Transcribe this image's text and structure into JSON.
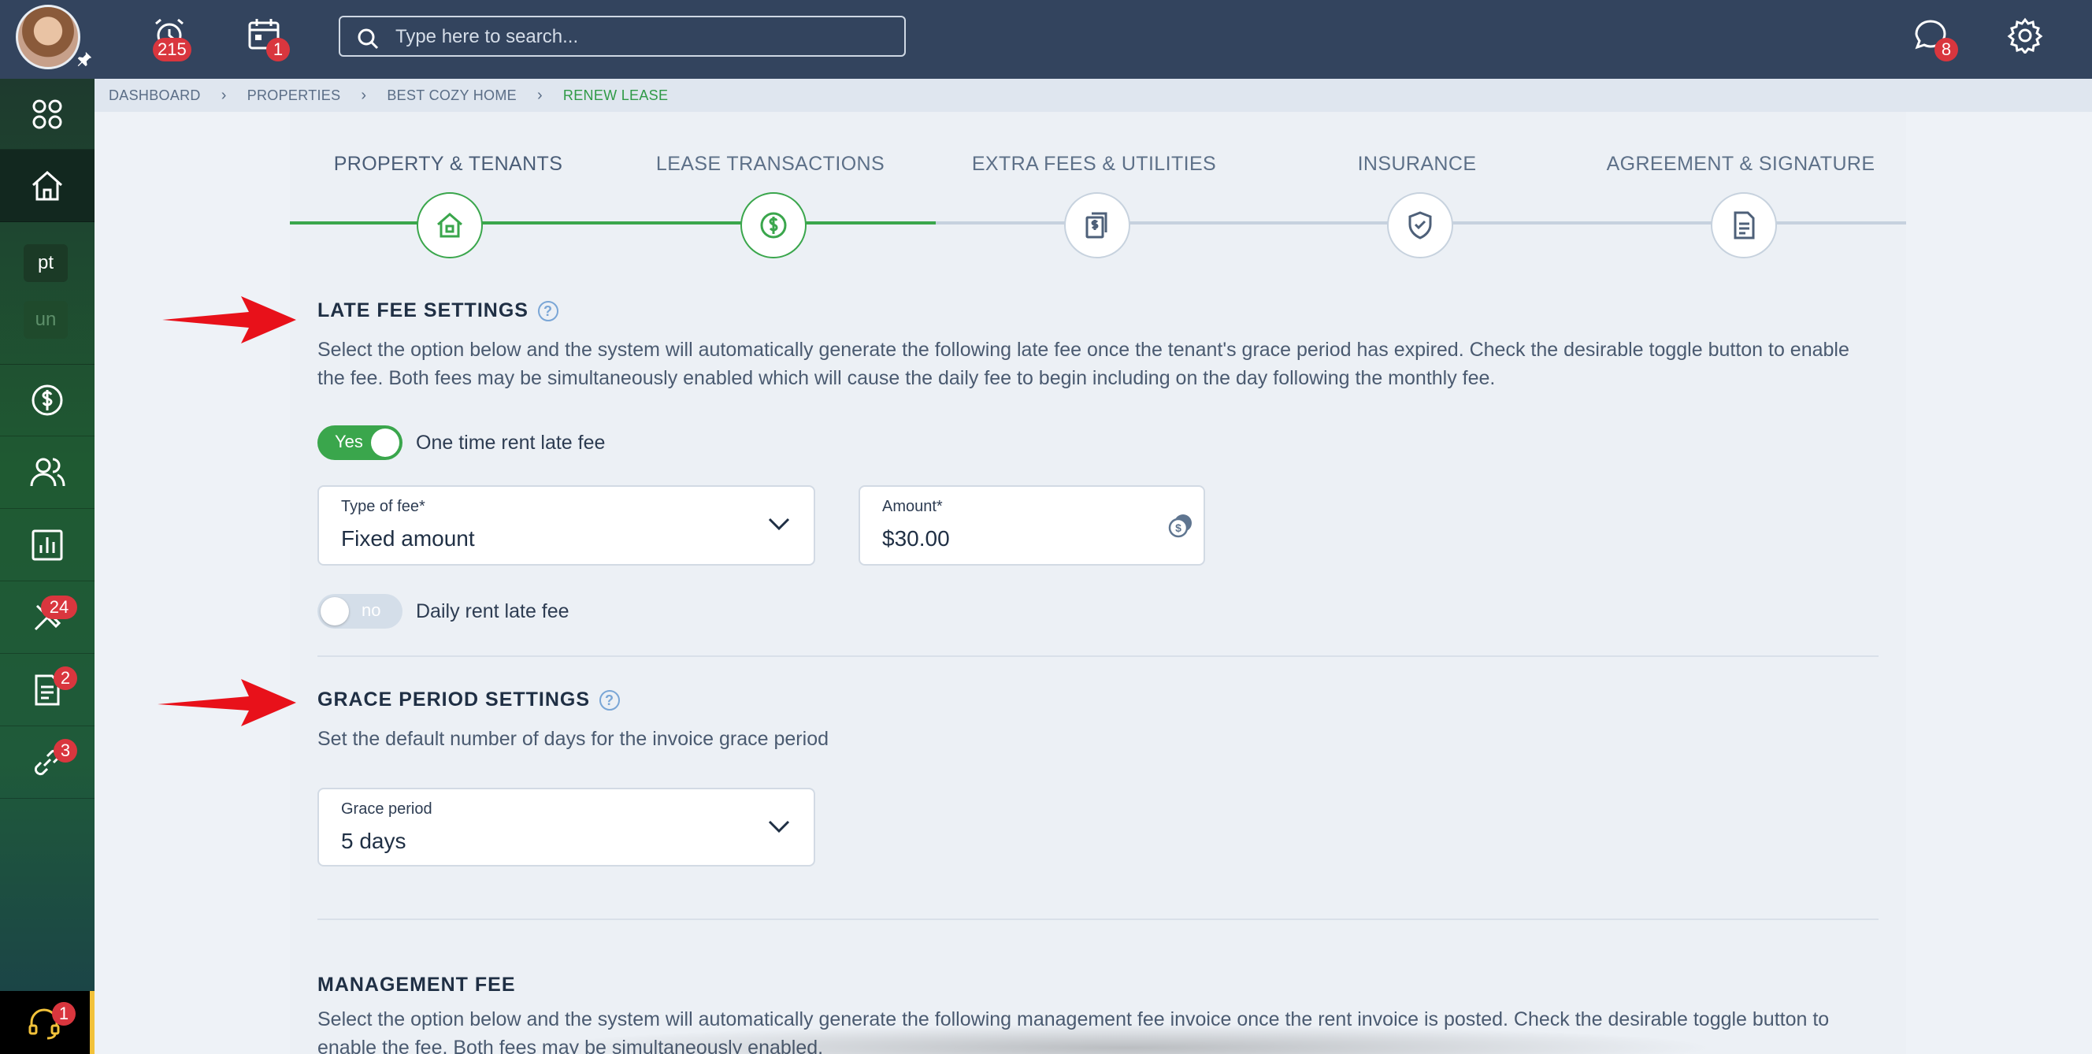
{
  "topbar": {
    "alarm_badge": "215",
    "calendar_badge": "1",
    "search_placeholder": "Type here to search...",
    "chat_badge": "8"
  },
  "sidebar": {
    "chip_pt": "pt",
    "chip_un": "un",
    "maintenance_badge": "24",
    "docs_badge": "2",
    "links_badge": "3",
    "support_badge": "1"
  },
  "breadcrumb": {
    "items": [
      "DASHBOARD",
      "PROPERTIES",
      "BEST COZY HOME"
    ],
    "current": "RENEW LEASE"
  },
  "steps": [
    {
      "label": "PROPERTY & TENANTS",
      "status": "done"
    },
    {
      "label": "LEASE TRANSACTIONS",
      "status": "current"
    },
    {
      "label": "EXTRA FEES & UTILITIES",
      "status": "pending"
    },
    {
      "label": "INSURANCE",
      "status": "pending"
    },
    {
      "label": "AGREEMENT & SIGNATURE",
      "status": "pending"
    }
  ],
  "late_fee": {
    "title": "LATE FEE SETTINGS",
    "description": "Select the option below and the system will automatically generate the following late fee once the tenant's grace period has expired. Check the desirable toggle button to enable the fee. Both fees may be simultaneously enabled which will cause the daily fee to begin including on the day following the monthly fee.",
    "one_time_toggle_label": "Yes",
    "one_time_text": "One time rent late fee",
    "type_label": "Type of fee*",
    "type_value": "Fixed amount",
    "amount_label": "Amount*",
    "amount_value": "$30.00",
    "daily_toggle_label": "no",
    "daily_text": "Daily rent late fee"
  },
  "grace": {
    "title": "GRACE PERIOD SETTINGS",
    "description": "Set the default number of days for the invoice grace period",
    "label": "Grace period",
    "value": "5 days"
  },
  "management": {
    "title": "MANAGEMENT FEE",
    "description": "Select the option below and the system will automatically generate the following management fee invoice once the rent invoice is posted. Check the desirable toggle button to enable the fee. Both fees may be simultaneously enabled."
  },
  "colors": {
    "topbar": "#33445e",
    "accent_green": "#3aa64c",
    "badge_red": "#d9363e",
    "breadcrumb_current": "#2f9a46",
    "annotation_arrow": "#e8111a"
  }
}
